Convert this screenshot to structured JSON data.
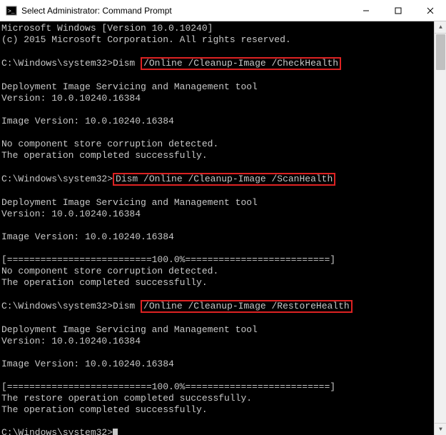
{
  "window": {
    "title": "Select Administrator: Command Prompt",
    "icon": "cmd-icon"
  },
  "terminal": {
    "line1": "Microsoft Windows [Version 10.0.10240]",
    "line2": "(c) 2015 Microsoft Corporation. All rights reserved.",
    "blank": "",
    "prompt1_path": "C:\\Windows\\system32>",
    "prompt1_cmd_pre": "Dism ",
    "prompt1_cmd_hl": "/Online /Cleanup-Image /CheckHealth",
    "dism_title": "Deployment Image Servicing and Management tool",
    "dism_ver": "Version: 10.0.10240.16384",
    "img_ver": "Image Version: 10.0.10240.16384",
    "no_corrupt": "No component store corruption detected.",
    "op_success": "The operation completed successfully.",
    "prompt2_path": "C:\\Windows\\system32>",
    "prompt2_cmd_hl": "Dism /Online /Cleanup-Image /ScanHealth",
    "progress": "[==========================100.0%==========================]",
    "prompt3_path": "C:\\Windows\\system32>",
    "prompt3_cmd_pre": "Dism ",
    "prompt3_cmd_hl": "/Online /Cleanup-Image /RestoreHealth",
    "restore_success": "The restore operation completed successfully.",
    "prompt4_path": "C:\\Windows\\system32>"
  }
}
